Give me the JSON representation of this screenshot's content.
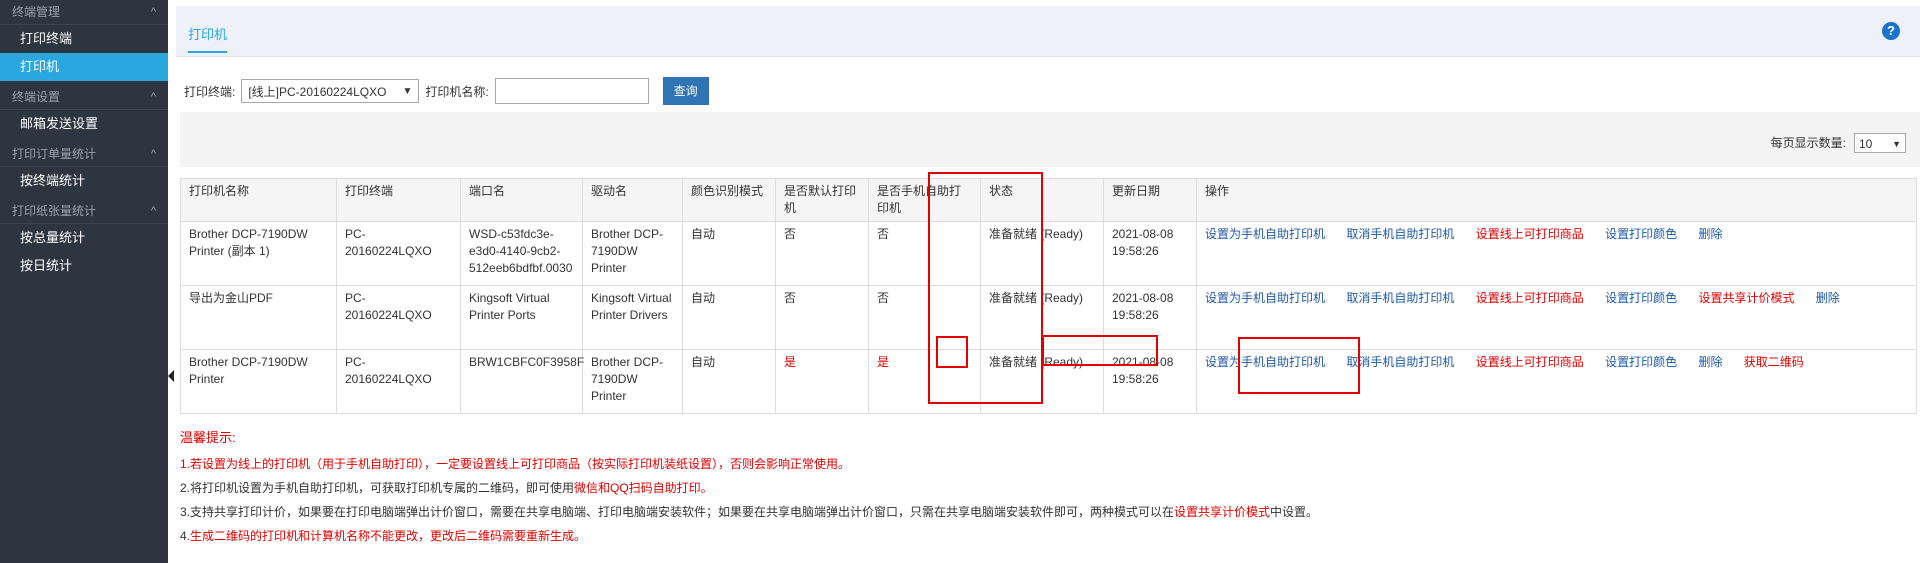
{
  "sidebar": {
    "sections": [
      {
        "title": "终端管理",
        "items": [
          "打印终端",
          "打印机"
        ]
      },
      {
        "title": "终端设置",
        "items": [
          "邮箱发送设置"
        ]
      },
      {
        "title": "打印订单量统计",
        "items": [
          "按终端统计"
        ]
      },
      {
        "title": "打印纸张量统计",
        "items": [
          "按总量统计",
          "按日统计"
        ]
      }
    ],
    "active_item": "打印机",
    "chevron": "^",
    "active_color": "#29a8e0"
  },
  "header": {
    "tab_label": "打印机",
    "help_icon": "?"
  },
  "filter": {
    "terminal_label": "打印终端:",
    "terminal_value": "[线上]PC-20160224LQXO",
    "printer_name_label": "打印机名称:",
    "printer_name_value": "",
    "query_button": "查询"
  },
  "pagination": {
    "page_size_label": "每页显示数量:",
    "page_size_value": "10"
  },
  "table": {
    "columns": [
      "打印机名称",
      "打印终端",
      "端口名",
      "驱动名",
      "颜色识别模式",
      "是否默认打印机",
      "是否手机自助打印机",
      "状态",
      "更新日期",
      "操作"
    ],
    "rows": [
      {
        "name": "Brother DCP-7190DW Printer (副本 1)",
        "terminal": "PC-20160224LQXO",
        "port": "WSD-c53fdc3e-e3d0-4140-9cb2-512eeb6bdfbf.0030",
        "driver": "Brother DCP-7190DW Printer",
        "color_mode": "自动",
        "is_default": "否",
        "is_mobile": "否",
        "status": "准备就绪 (Ready)",
        "updated": "2021-08-08 19:58:26",
        "actions": [
          {
            "label": "设置为手机自助打印机",
            "red": false
          },
          {
            "label": "取消手机自助打印机",
            "red": false
          },
          {
            "label": "设置线上可打印商品",
            "red": true
          },
          {
            "label": "设置打印颜色",
            "red": false
          },
          {
            "label": "删除",
            "red": false
          }
        ]
      },
      {
        "name": "导出为金山PDF",
        "terminal": "PC-20160224LQXO",
        "port": "Kingsoft Virtual Printer Ports",
        "driver": "Kingsoft Virtual Printer Drivers",
        "color_mode": "自动",
        "is_default": "否",
        "is_mobile": "否",
        "status": "准备就绪 (Ready)",
        "updated": "2021-08-08 19:58:26",
        "actions": [
          {
            "label": "设置为手机自助打印机",
            "red": false
          },
          {
            "label": "取消手机自助打印机",
            "red": false
          },
          {
            "label": "设置线上可打印商品",
            "red": true
          },
          {
            "label": "设置打印颜色",
            "red": false
          },
          {
            "label": "设置共享计价模式",
            "red": true
          },
          {
            "label": "删除",
            "red": false
          }
        ]
      },
      {
        "name": "Brother DCP-7190DW Printer",
        "terminal": "PC-20160224LQXO",
        "port": "BRW1CBFC0F3958F",
        "driver": "Brother DCP-7190DW Printer",
        "color_mode": "自动",
        "is_default": "是",
        "is_mobile": "是",
        "status": "准备就绪 (Ready)",
        "updated": "2021-08-08 19:58:26",
        "actions": [
          {
            "label": "设置为手机自助打印机",
            "red": false
          },
          {
            "label": "取消手机自助打印机",
            "red": false
          },
          {
            "label": "设置线上可打印商品",
            "red": true
          },
          {
            "label": "设置打印颜色",
            "red": false
          },
          {
            "label": "删除",
            "red": false
          },
          {
            "label": "获取二维码",
            "red": true
          }
        ]
      }
    ]
  },
  "tips": {
    "title": "温馨提示:",
    "lines": [
      [
        {
          "t": "1.若设置为线上的打印机（用于手机自助打印），一定要设置线上可打印商品（按实际打印机装纸设置），否则会影响正常使用。",
          "red": true
        }
      ],
      [
        {
          "t": "2.将打印机设置为手机自助打印机，可获取打印机专属的二维码，即可使用",
          "red": false
        },
        {
          "t": "微信和QQ扫码自助打印。",
          "red": true
        }
      ],
      [
        {
          "t": "3.支持共享打印计价，如果要在打印电脑端弹出计价窗口，需要在共享电脑端、打印电脑端安装软件；如果要在共享电脑端弹出计价窗口，只需在共享电脑端安装软件即可，两种模式可以在",
          "red": false
        },
        {
          "t": "设置共享计价模式",
          "red": true
        },
        {
          "t": "中设置。",
          "red": false
        }
      ],
      [
        {
          "t": "4.",
          "red": false
        },
        {
          "t": "生成二维码的打印机和计算机名称不能更改，更改后二维码需要重新生成。",
          "red": true
        }
      ]
    ]
  },
  "colors": {
    "accent": "#29a8e0",
    "sidebar_bg": "#2d3640",
    "highlight_red": "#e00000",
    "link_blue": "#1e5aa8",
    "button_blue": "#2f75b5"
  }
}
